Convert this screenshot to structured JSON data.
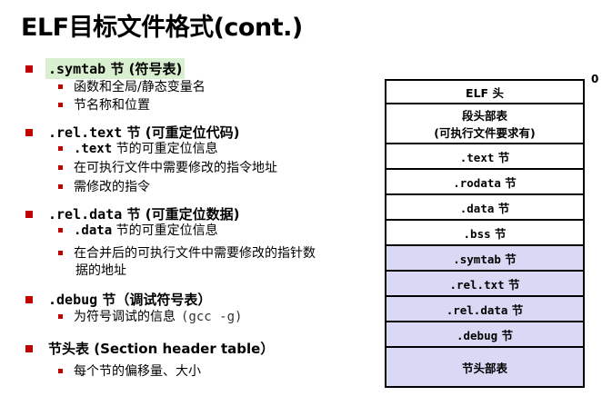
{
  "title": "ELF目标文件格式(cont.)",
  "bullets": [
    {
      "code": ".symtab",
      "label": " 节 (符号表)",
      "subs": [
        {
          "text": "函数和全局/静态变量名"
        },
        {
          "text": "节名称和位置"
        }
      ]
    },
    {
      "code": ".rel.text",
      "label": " 节 (可重定位代码)",
      "subs": [
        {
          "code": ".text",
          "text": " 节的可重定位信息"
        },
        {
          "text": "在可执行文件中需要修改的指令地址"
        },
        {
          "text": "需修改的指令"
        }
      ]
    },
    {
      "code": ".rel.data",
      "label": " 节 (可重定位数据)",
      "subs": [
        {
          "code": ".data",
          "text": " 节的可重定位信息"
        },
        {
          "text": "在合并后的可执行文件中需要修改的指针数",
          "text2": "据的地址"
        }
      ]
    },
    {
      "code": ".debug",
      "label": " 节（调试符号表）",
      "subs": [
        {
          "text": "为符号调试的信息",
          "gcc": "(gcc -g)"
        }
      ]
    },
    {
      "label": "节头表 (Section header table）",
      "subs": [
        {
          "text": "每个节的偏移量、大小"
        }
      ]
    }
  ],
  "figure": {
    "offset_label": "0",
    "blocks": [
      {
        "text": "ELF 头",
        "fill": "#ffffff"
      },
      {
        "text": "段头部表",
        "text2": "(可执行文件要求有)",
        "fill": "#ffffff"
      },
      {
        "code": ".text",
        "text": " 节",
        "fill": "#ffffff"
      },
      {
        "code": ".rodata",
        "text": " 节",
        "fill": "#ffffff"
      },
      {
        "code": ".data",
        "text": " 节",
        "fill": "#ffffff"
      },
      {
        "code": ".bss",
        "text": " 节",
        "fill": "#ffffff"
      },
      {
        "code": ".symtab",
        "text": " 节",
        "fill": "#d9d9f5"
      },
      {
        "code": ".rel.txt",
        "text": " 节",
        "fill": "#d9d9f5"
      },
      {
        "code": ".rel.data",
        "text": " 节",
        "fill": "#d9d9f5"
      },
      {
        "code": ".debug",
        "text": " 节",
        "fill": "#d9d9f5"
      },
      {
        "text": "节头部表",
        "fill": "#d9d9f5"
      }
    ]
  },
  "colors": {
    "bullet": "#c00000",
    "highlight": "#d9f0d0",
    "section_fill": "#d9d9f5"
  }
}
